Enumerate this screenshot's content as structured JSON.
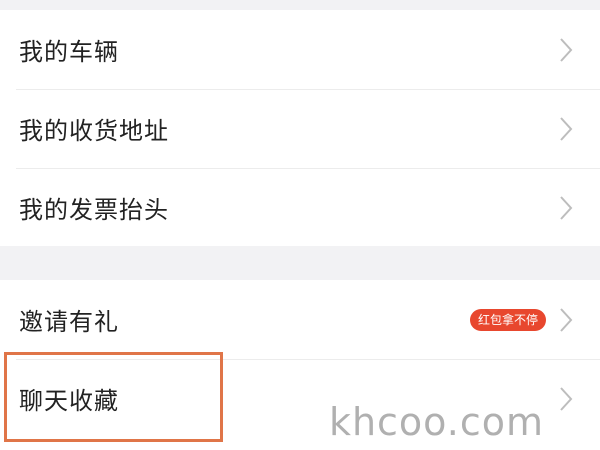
{
  "menu_group_1": [
    {
      "label": "我的车辆"
    },
    {
      "label": "我的收货地址"
    },
    {
      "label": "我的发票抬头"
    }
  ],
  "menu_group_2": [
    {
      "label": "邀请有礼",
      "badge": "红包拿不停"
    },
    {
      "label": "聊天收藏"
    }
  ],
  "watermark": "khcoo.com",
  "colors": {
    "badge": "#e8472e",
    "highlight": "#e07548",
    "background": "#f2f2f4"
  },
  "icons": {
    "chevron": "chevron-right-icon"
  }
}
